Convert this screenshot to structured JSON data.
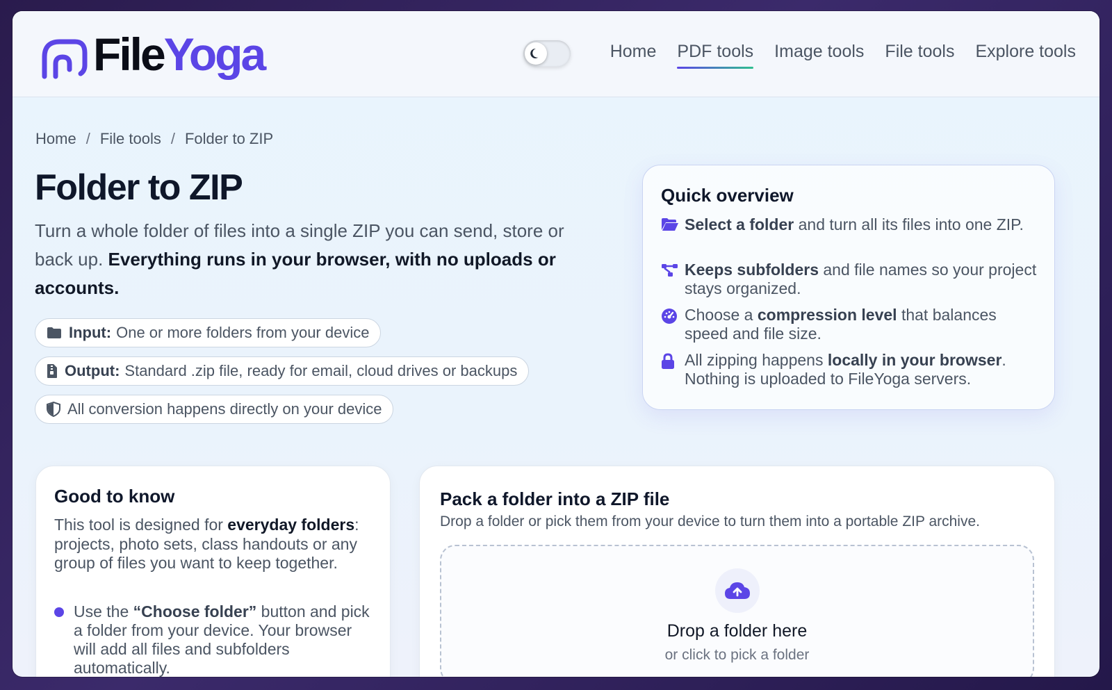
{
  "brand": {
    "part1": "File",
    "part2": "Yoga",
    "accent": "#5b45e6"
  },
  "theme_toggle": {
    "icon": "moon-icon"
  },
  "nav": {
    "items": [
      {
        "label": "Home"
      },
      {
        "label": "PDF tools"
      },
      {
        "label": "Image tools"
      },
      {
        "label": "File tools"
      },
      {
        "label": "Explore tools"
      }
    ],
    "active": "PDF tools"
  },
  "breadcrumb": {
    "items": [
      "Home",
      "File tools",
      "Folder to ZIP"
    ],
    "separator": "/"
  },
  "page": {
    "title": "Folder to ZIP",
    "lead_plain": "Turn a whole folder of files into a single ZIP you can send, store or back up. ",
    "lead_bold": "Everything runs in your browser, with no uploads or accounts."
  },
  "pills": [
    {
      "icon": "folder-icon",
      "label": "Input:",
      "text": "One or more folders from your device"
    },
    {
      "icon": "zip-file-icon",
      "label": "Output:",
      "text": "Standard .zip file, ready for email, cloud drives or backups"
    },
    {
      "icon": "shield-icon",
      "label": "",
      "text": "All conversion happens directly on your device"
    }
  ],
  "overview": {
    "title": "Quick overview",
    "items": [
      {
        "icon": "folder-open-icon",
        "pre": "",
        "bold": "Select a folder",
        "post": " and turn all its files into one ZIP."
      },
      {
        "icon": "tree-icon",
        "pre": "",
        "bold": "Keeps subfolders",
        "post": " and file names so your project stays organized."
      },
      {
        "icon": "gauge-icon",
        "pre": "Choose a ",
        "bold": "compression level",
        "post": " that balances speed and file size."
      },
      {
        "icon": "lock-icon",
        "pre": "All zipping happens ",
        "bold": "locally in your browser",
        "post": ". Nothing is uploaded to FileYoga servers."
      }
    ]
  },
  "good_to_know": {
    "title": "Good to know",
    "text_pre": "This tool is designed for ",
    "text_bold": "everyday folders",
    "text_post": ": projects, photo sets, class handouts or any group of files you want to keep together.",
    "bullet_pre": "Use the ",
    "bullet_bold": "“Choose folder”",
    "bullet_post": " button and pick a folder from your device. Your browser will add all files and subfolders automatically."
  },
  "pack": {
    "title": "Pack a folder into a ZIP file",
    "subtitle": "Drop a folder or pick them from your device to turn them into a portable ZIP archive.",
    "dropzone_icon": "cloud-upload-icon",
    "dropzone_title": "Drop a folder here",
    "dropzone_sub": "or click to pick a folder"
  }
}
